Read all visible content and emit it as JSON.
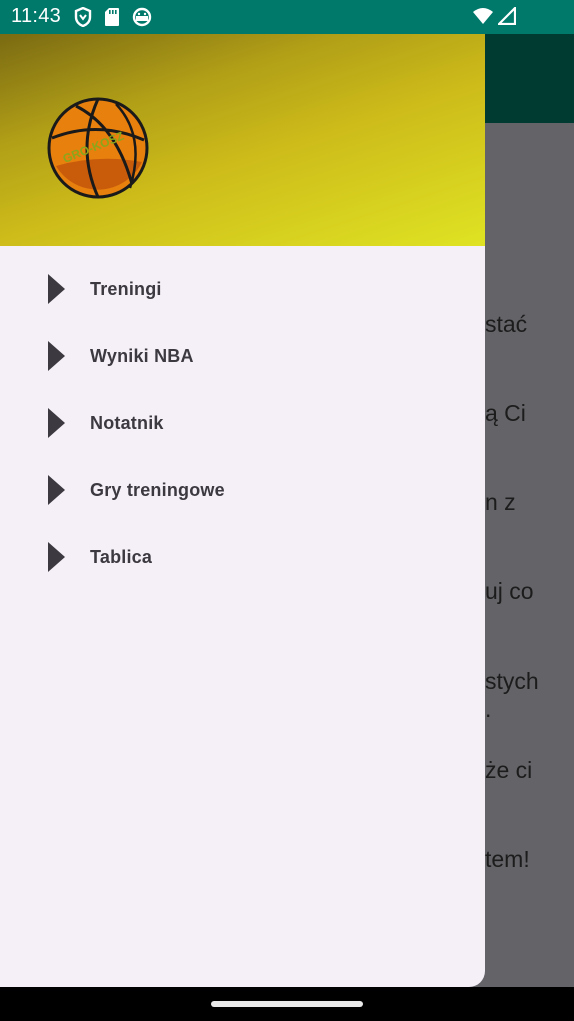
{
  "status_bar": {
    "time": "11:43",
    "icons_left": [
      "vpn-shield-icon",
      "sd-card-icon",
      "android-face-icon"
    ],
    "icons_right": [
      "wifi-icon",
      "cell-signal-icon"
    ]
  },
  "background_app": {
    "toolbar_color": "#003b32",
    "scrim_color": "#646368",
    "visible_text_fragments": [
      "stać",
      "ą Ci",
      "n z",
      "uj co",
      "stych",
      ".",
      "że ci",
      "tem!"
    ]
  },
  "drawer": {
    "header_logo": "basketball-logo",
    "logo_text": "GRO-KOSZ",
    "menu_items": [
      {
        "label": "Treningi",
        "icon": "play-arrow-icon"
      },
      {
        "label": "Wyniki NBA",
        "icon": "play-arrow-icon"
      },
      {
        "label": "Notatnik",
        "icon": "play-arrow-icon"
      },
      {
        "label": "Gry treningowe",
        "icon": "play-arrow-icon"
      },
      {
        "label": "Tablica",
        "icon": "play-arrow-icon"
      }
    ]
  },
  "colors": {
    "status_bar": "#00796b",
    "drawer_bg": "#f5f0f7",
    "menu_text": "#3c3a40",
    "header_gradient_start": "#7a6a12",
    "header_gradient_end": "#dfe323"
  }
}
